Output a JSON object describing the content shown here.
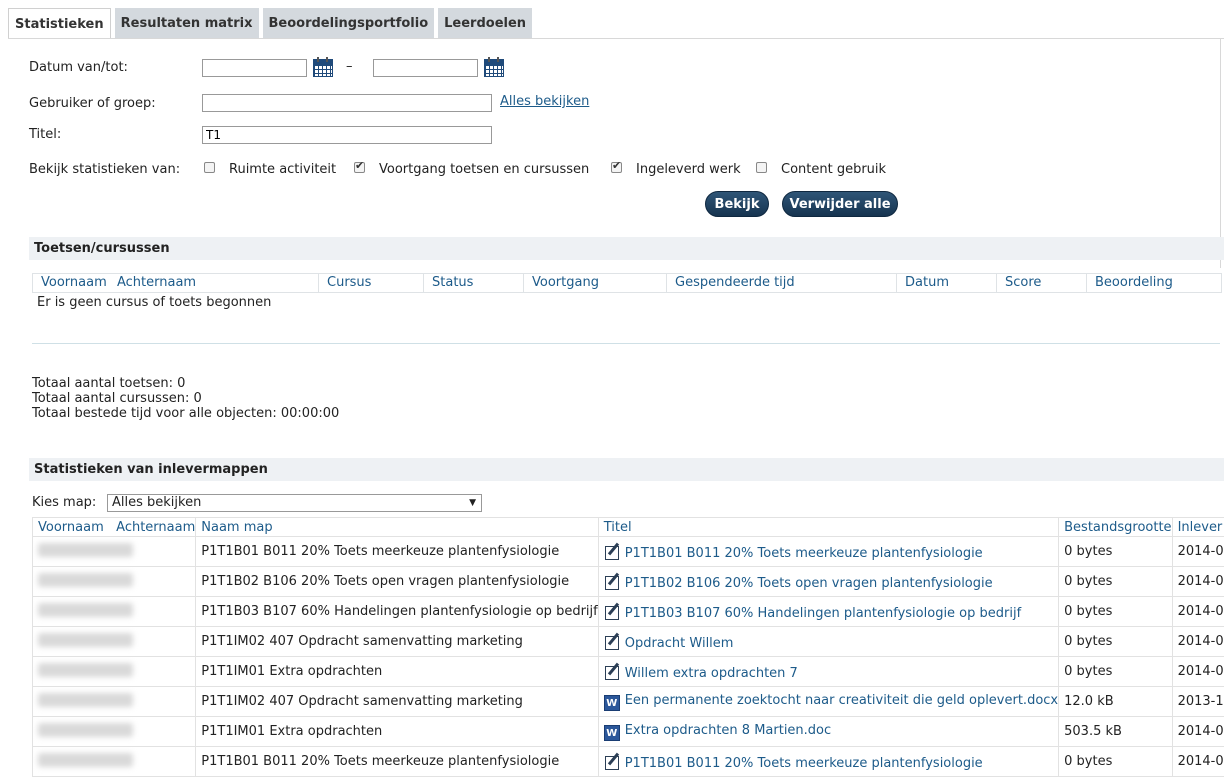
{
  "tabs": [
    "Statistieken",
    "Resultaten matrix",
    "Beoordelingsportfolio",
    "Leerdoelen"
  ],
  "form": {
    "date_label": "Datum van/tot:",
    "date_sep": "–",
    "date_from": "",
    "date_to": "",
    "user_label": "Gebruiker of groep:",
    "user_value": "",
    "view_all_link": "Alles bekijken",
    "title_label": "Titel:",
    "title_value": "T1",
    "stats_label": "Bekijk statistieken van:",
    "checkboxes": [
      {
        "label": "Ruimte activiteit",
        "checked": false
      },
      {
        "label": "Voortgang toetsen en cursussen",
        "checked": true
      },
      {
        "label": "Ingeleverd werk",
        "checked": true
      },
      {
        "label": "Content gebruik",
        "checked": false
      }
    ],
    "view_button": "Bekijk",
    "remove_all_button": "Verwijder alle"
  },
  "tests": {
    "section_title": "Toetsen/cursussen",
    "columns": [
      "Voornaam",
      "Achternaam",
      "Cursus",
      "Status",
      "Voortgang",
      "Gespendeerde tijd",
      "Datum",
      "Score",
      "Beoordeling"
    ],
    "empty_text": "Er is geen cursus of toets begonnen",
    "total_tests": "Totaal aantal toetsen: 0",
    "total_courses": "Totaal aantal cursussen: 0",
    "total_time": "Totaal bestede tijd voor alle objecten: 00:00:00"
  },
  "submissions": {
    "section_title": "Statistieken van inlevermappen",
    "folder_label": "Kies map:",
    "folder_selected": "Alles bekijken",
    "columns": [
      "Voornaam",
      "Achternaam",
      "Naam map",
      "Titel",
      "Bestandsgrootte",
      "Inlever"
    ],
    "rows": [
      {
        "folder": "P1T1B01 B011 20% Toets meerkeuze plantenfysiologie",
        "icon": "edit-icon",
        "title": "P1T1B01 B011 20% Toets meerkeuze plantenfysiologie",
        "size": "0 bytes",
        "date": "2014-0"
      },
      {
        "folder": "P1T1B02 B106 20% Toets open vragen plantenfysiologie",
        "icon": "edit-icon",
        "title": "P1T1B02 B106 20% Toets open vragen plantenfysiologie",
        "size": "0 bytes",
        "date": "2014-0"
      },
      {
        "folder": "P1T1B03 B107 60% Handelingen plantenfysiologie op bedrijf",
        "icon": "edit-icon",
        "title": "P1T1B03 B107 60% Handelingen plantenfysiologie op bedrijf",
        "size": "0 bytes",
        "date": "2014-0"
      },
      {
        "folder": "P1T1IM02 407 Opdracht samenvatting marketing",
        "icon": "edit-icon",
        "title": "Opdracht Willem",
        "size": "0 bytes",
        "date": "2014-0"
      },
      {
        "folder": "P1T1IM01 Extra opdrachten",
        "icon": "edit-icon",
        "title": "Willem extra opdrachten 7",
        "size": "0 bytes",
        "date": "2014-0"
      },
      {
        "folder": "P1T1IM02 407 Opdracht samenvatting marketing",
        "icon": "word-icon",
        "title": "Een permanente zoektocht naar creativiteit die geld oplevert.docx",
        "size": "12.0 kB",
        "date": "2013-1"
      },
      {
        "folder": "P1T1IM01 Extra opdrachten",
        "icon": "word-icon",
        "title": "Extra opdrachten 8 Martien.doc",
        "size": "503.5 kB",
        "date": "2014-0"
      },
      {
        "folder": "P1T1B01 B011 20% Toets meerkeuze plantenfysiologie",
        "icon": "edit-icon",
        "title": "P1T1B01 B011 20% Toets meerkeuze plantenfysiologie",
        "size": "0 bytes",
        "date": "2014-0"
      }
    ]
  }
}
